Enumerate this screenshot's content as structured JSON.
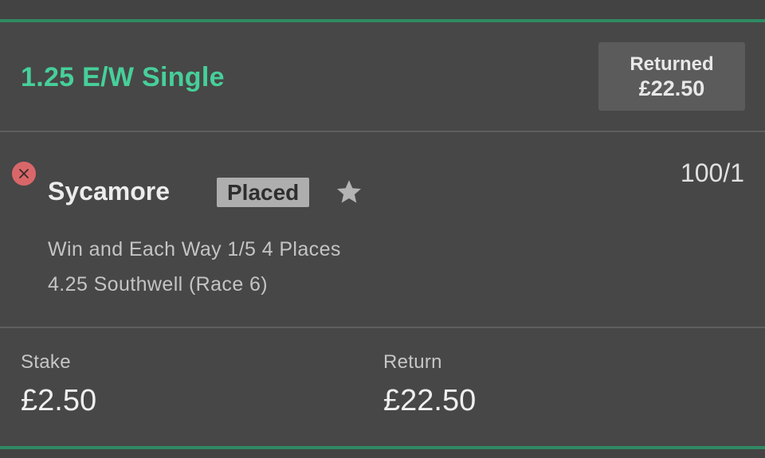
{
  "header": {
    "bet_title": "1.25 E/W Single",
    "status_label": "Returned",
    "status_amount": "£22.50"
  },
  "selection": {
    "runner": "Sycamore",
    "badge": "Placed",
    "odds": "100/1",
    "market": "Win and Each Way 1/5 4 Places",
    "event": "4.25 Southwell (Race 6)"
  },
  "summary": {
    "stake_label": "Stake",
    "stake_value": "£2.50",
    "return_label": "Return",
    "return_value": "£22.50"
  },
  "icons": {
    "close": "close-icon",
    "star": "star-icon"
  },
  "colors": {
    "accent_green": "#47cf9a",
    "bar_green": "#2f8a63",
    "background": "#474747",
    "loss_red": "#d9676a"
  }
}
